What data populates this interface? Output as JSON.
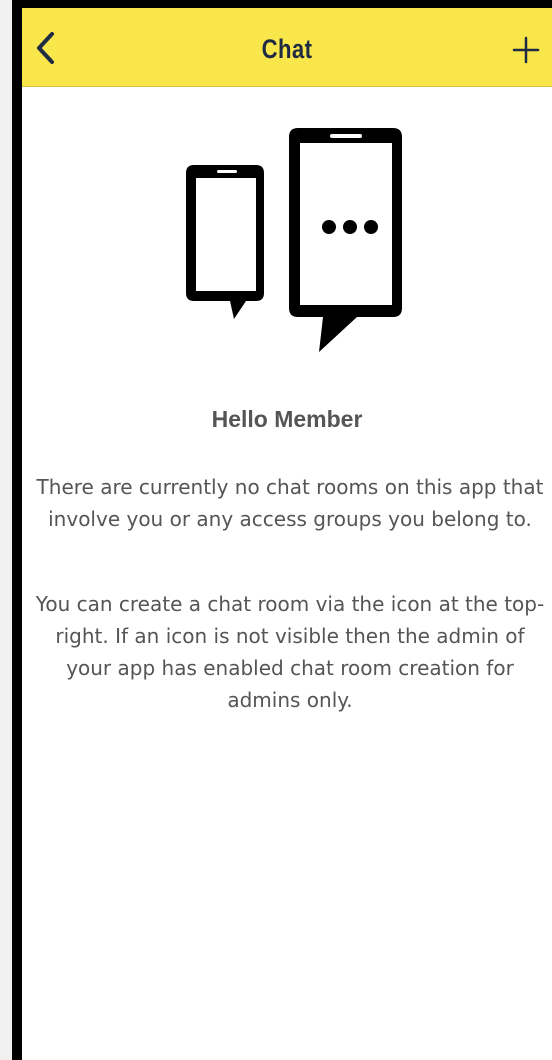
{
  "nav": {
    "title": "Chat",
    "back_icon": "chevron-left-icon",
    "add_icon": "plus-icon"
  },
  "empty_state": {
    "illustration_icon": "chat-phones-icon",
    "greeting": "Hello Member",
    "message_one": "There are currently no chat rooms on this app that involve you or any access groups you belong to.",
    "message_two": "You can create a chat room via the icon at the top-right. If an icon is not visible then the admin of your app has enabled chat room creation for admins only."
  },
  "colors": {
    "nav_background": "#f9e64b",
    "nav_foreground": "#1f2a44",
    "body_text": "#555555",
    "illustration": "#000000"
  }
}
